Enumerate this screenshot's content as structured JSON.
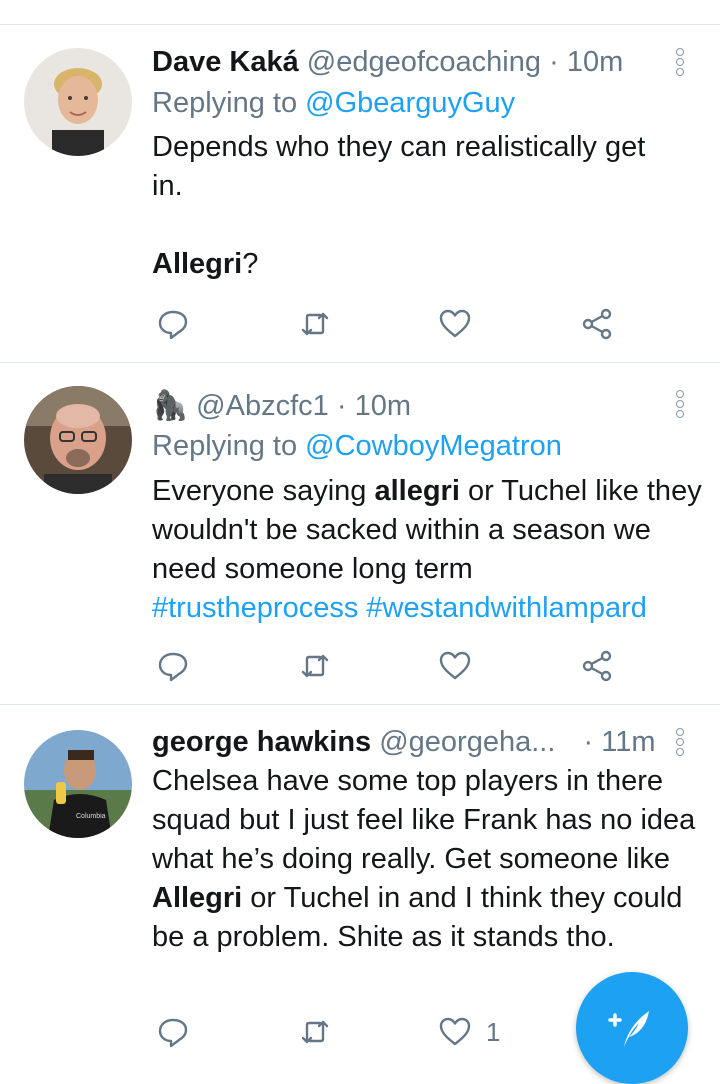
{
  "tweets": [
    {
      "display_name": "Dave Kaká",
      "handle": "@edgeofcoaching",
      "sep": "·",
      "time": "10m",
      "replying_prefix": "Replying to ",
      "replying_to": "@GbearguyGuy",
      "text_line1": "Depends who they can realistically get in.",
      "text_bold": "Allegri",
      "text_after_bold": "?",
      "likes": ""
    },
    {
      "display_name": "🦍",
      "handle": "@Abzcfc1",
      "sep": "·",
      "time": "10m",
      "replying_prefix": "Replying to ",
      "replying_to": "@CowboyMegatron",
      "text_before_bold": "Everyone saying ",
      "text_bold": "allegri",
      "text_after_bold": " or Tuchel like they wouldn't be sacked within a season we need someone long term",
      "hashtag1": "#trustheprocess",
      "hashtag2": "#westandwithlampard",
      "likes": ""
    },
    {
      "display_name": "george hawkins",
      "handle": "@georgeha...",
      "sep": "·",
      "time": "11m",
      "text_before_bold": "Chelsea have some top players in there squad but I just feel like Frank has no idea what he’s doing really. Get someone like ",
      "text_bold": "Allegri",
      "text_after_bold": " or Tuchel in and I think they could be a problem. Shite as it stands tho.",
      "likes": "1"
    }
  ],
  "icons": {
    "reply": "reply-icon",
    "retweet": "retweet-icon",
    "like": "heart-icon",
    "share": "share-icon",
    "more": "more-vertical-icon",
    "compose": "compose-tweet-icon"
  },
  "colors": {
    "accent": "#1da1f2",
    "muted": "#657786",
    "text": "#14171a",
    "divider": "#e1e8ed"
  }
}
